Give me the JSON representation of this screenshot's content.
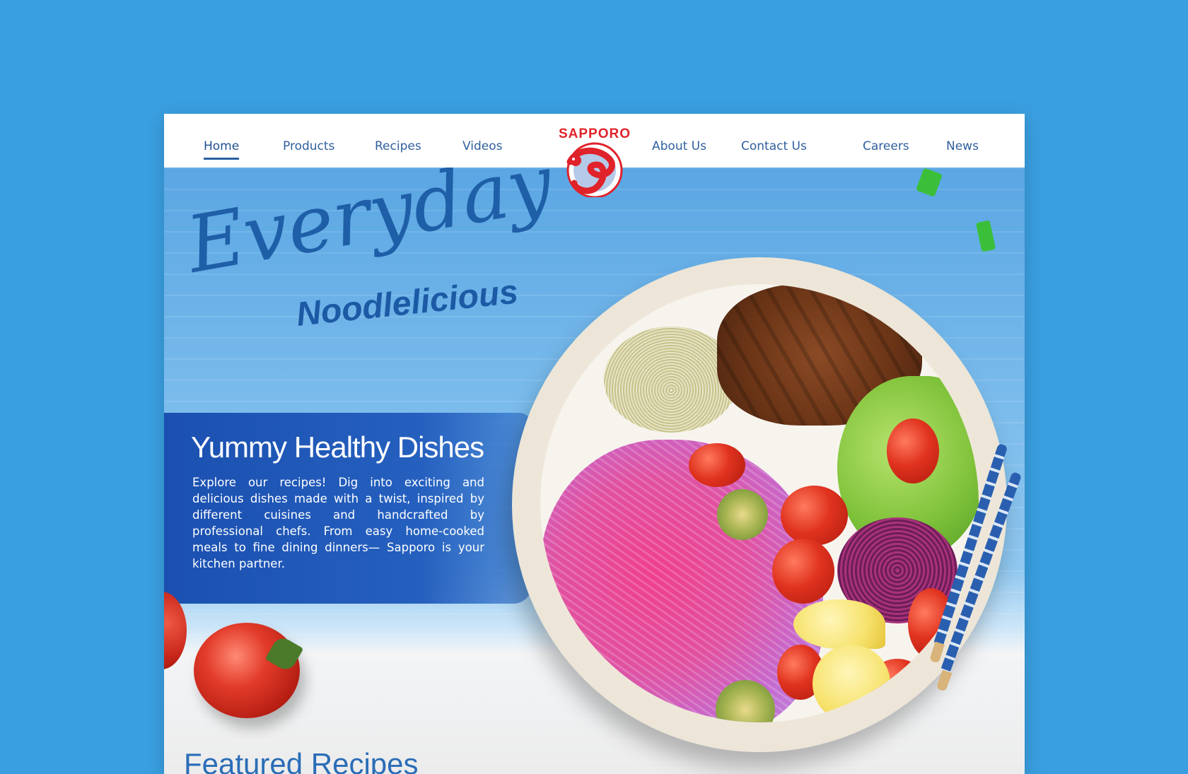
{
  "nav": {
    "left_items": [
      {
        "label": "Home",
        "active": true
      },
      {
        "label": "Products",
        "active": false
      },
      {
        "label": "Recipes",
        "active": false
      },
      {
        "label": "Videos",
        "active": false
      }
    ],
    "right_items": [
      {
        "label": "About Us",
        "active": false
      },
      {
        "label": "Contact Us",
        "active": false
      },
      {
        "label": "Careers",
        "active": false
      },
      {
        "label": "News",
        "active": false
      }
    ]
  },
  "logo": {
    "text": "SAPPORO",
    "icon": "dragon-logo"
  },
  "hero": {
    "headline_script": "Everyday",
    "headline_sub": "Noodlelicious",
    "title": "Yummy Healthy Dishes",
    "text": "Explore our recipes! Dig into exciting and delicious dishes made with a twist, inspired by different cuisines and handcrafted by professional chefs. From easy home-cooked meals to fine dining dinners— Sapporo is your kitchen partner."
  },
  "featured": {
    "title": "Featured Recipes"
  },
  "colors": {
    "background": "#3a9fe0",
    "nav_text": "#2f5f9e",
    "brand_red": "#e0222a",
    "hero_panel": "#1b50b0",
    "featured_title": "#2a6db7"
  }
}
